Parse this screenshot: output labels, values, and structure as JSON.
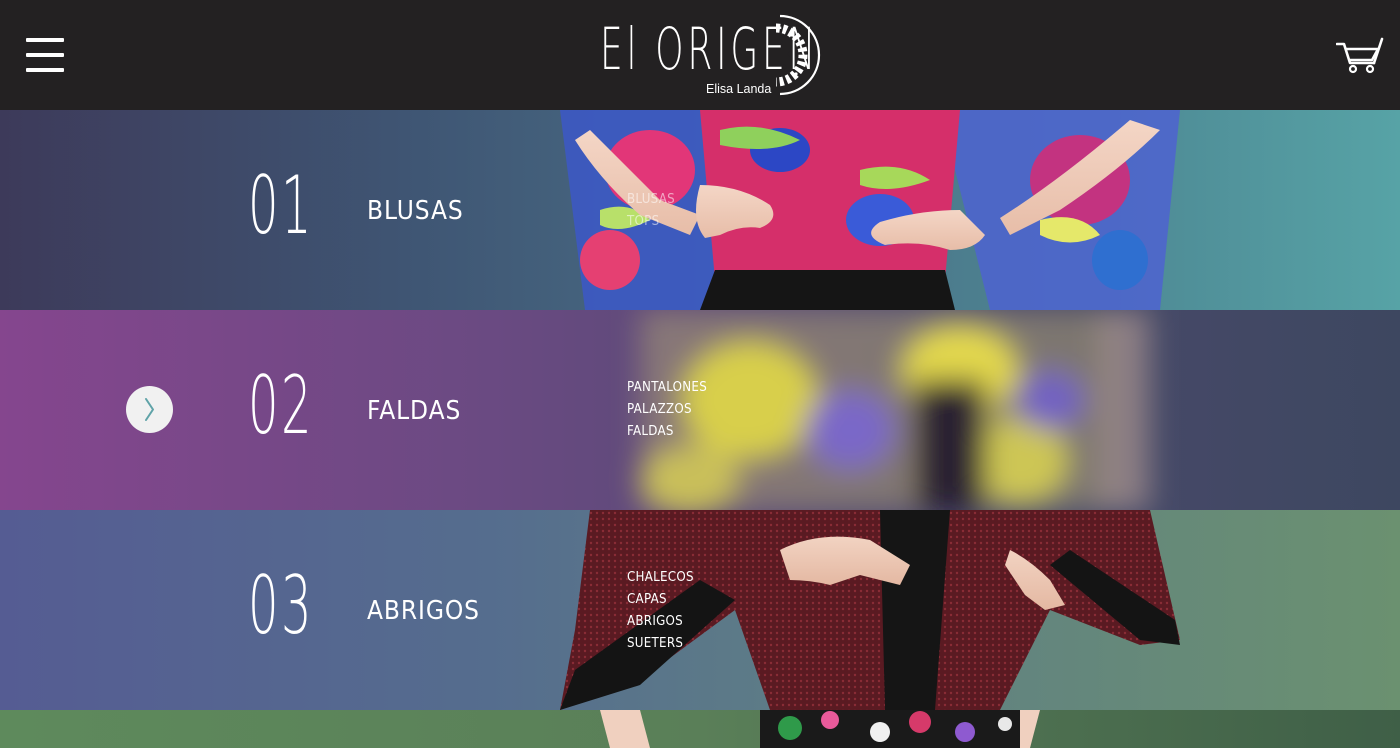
{
  "header": {
    "brand": "El ORIGEN",
    "brand_sub": "Elisa Landa",
    "menu_icon": "hamburger-menu-icon",
    "cart_icon": "shopping-cart-icon"
  },
  "categories": [
    {
      "number": "01",
      "title": "BLUSAS",
      "items": [
        "BLUSAS",
        "TOPS"
      ]
    },
    {
      "number": "02",
      "title": "FALDAS",
      "items": [
        "PANTALONES",
        "PALAZZOS",
        "FALDAS"
      ],
      "active": true
    },
    {
      "number": "03",
      "title": "ABRIGOS",
      "items": [
        "CHALECOS",
        "CAPAS",
        "ABRIGOS",
        "SUETERS"
      ]
    }
  ],
  "active_indicator_icon": "chevron-right-icon",
  "colors": {
    "header_bg": "#232122",
    "row1_accent": "#4d8793",
    "row2_accent": "#85468e",
    "row3_accent": "#555c93",
    "arrow_color": "#5fa3a8"
  }
}
